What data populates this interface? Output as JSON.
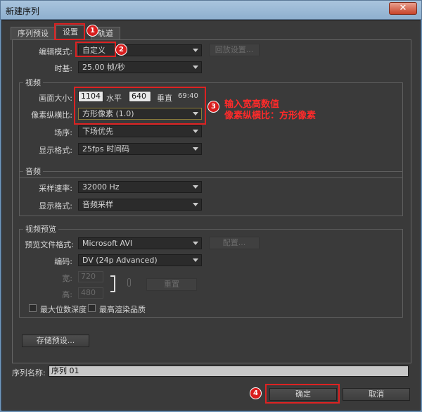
{
  "window": {
    "title": "新建序列",
    "close": "✕"
  },
  "tabs": [
    {
      "label": "序列预设"
    },
    {
      "label": "设置"
    },
    {
      "label": "轨道"
    }
  ],
  "settings": {
    "edit_mode_label": "编辑模式:",
    "edit_mode_value": "自定义",
    "play_settings_button": "回放设置...",
    "timebase_label": "时基:",
    "timebase_value": "25.00 帧/秒"
  },
  "video": {
    "group_title": "视频",
    "frame_size_label": "画面大小:",
    "frame_width": "1104",
    "horizontal_label": "水平",
    "frame_height": "640",
    "vertical_label": "垂直",
    "aspect_readout": "69:40",
    "pixel_aspect_label": "像素纵横比:",
    "pixel_aspect_value": "方形像素 (1.0)",
    "field_order_label": "场序:",
    "field_order_value": "下场优先",
    "display_format_label": "显示格式:",
    "display_format_value": "25fps 时间码"
  },
  "audio": {
    "group_title": "音频",
    "sample_rate_label": "采样速率:",
    "sample_rate_value": "32000 Hz",
    "display_format_label": "显示格式:",
    "display_format_value": "音频采样"
  },
  "preview": {
    "group_title": "视频预览",
    "file_format_label": "预览文件格式:",
    "file_format_value": "Microsoft AVI",
    "config_button": "配置...",
    "codec_label": "编码:",
    "codec_value": "DV (24p Advanced)",
    "width_label": "宽:",
    "width_value": "720",
    "height_label": "高:",
    "height_value": "480",
    "reset_button": "重置",
    "max_bit_depth_label": "最大位数深度",
    "max_render_quality_label": "最高渲染品质"
  },
  "save_preset_button": "存储预设...",
  "sequence_name_label": "序列名称:",
  "sequence_name_value": "序列 01",
  "ok_button": "确定",
  "cancel_button": "取消",
  "annotations": {
    "badge1": "1",
    "badge2": "2",
    "badge3": "3",
    "badge4": "4",
    "note_line1": "输入宽高数值",
    "note_line2": "像素纵横比：方形像素"
  },
  "colors": {
    "annotation_red": "#d22222",
    "panel_bg": "#3a3a3a"
  }
}
